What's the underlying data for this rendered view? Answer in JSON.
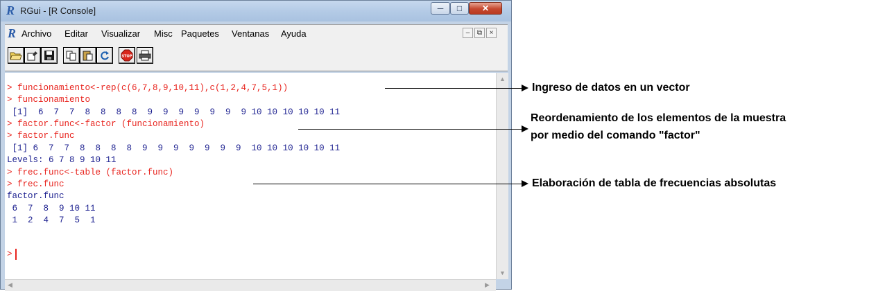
{
  "window": {
    "title": "RGui - [R Console]",
    "logo": "R",
    "caption_buttons": [
      "minimize-icon",
      "maximize-icon",
      "close-icon"
    ]
  },
  "menubar": {
    "logo": "R",
    "items": [
      "Archivo",
      "Editar",
      "Visualizar",
      "Misc",
      "Paquetes",
      "Ventanas",
      "Ayuda"
    ]
  },
  "toolbar": {
    "buttons": [
      "open-script-icon",
      "load-workspace-icon",
      "save-icon",
      "copy-icon",
      "paste-icon",
      "refresh-icon",
      "stop-icon",
      "print-icon"
    ],
    "stop_label": "STOP"
  },
  "console": {
    "lines": [
      {
        "type": "cmd",
        "text": "> funcionamiento<-rep(c(6,7,8,9,10,11),c(1,2,4,7,5,1))"
      },
      {
        "type": "cmd",
        "text": "> funcionamiento"
      },
      {
        "type": "out",
        "text": " [1]  6  7  7  8  8  8  8  9  9  9  9  9  9  9 10 10 10 10 10 11"
      },
      {
        "type": "cmd",
        "text": "> factor.func<-factor (funcionamiento)"
      },
      {
        "type": "cmd",
        "text": "> factor.func"
      },
      {
        "type": "out",
        "text": " [1] 6  7  7  8  8  8  8  9  9  9  9  9  9  9  10 10 10 10 10 11"
      },
      {
        "type": "out",
        "text": "Levels: 6 7 8 9 10 11"
      },
      {
        "type": "cmd",
        "text": "> frec.func<-table (factor.func)"
      },
      {
        "type": "cmd",
        "text": "> frec.func"
      },
      {
        "type": "out",
        "text": "factor.func"
      },
      {
        "type": "out",
        "text": " 6  7  8  9 10 11"
      },
      {
        "type": "out",
        "text": " 1  2  4  7  5  1"
      },
      {
        "type": "cmd",
        "text": "> "
      }
    ]
  },
  "annotations": [
    {
      "text": "Ingreso de datos en un vector"
    },
    {
      "text": "Reordenamiento de los elementos de la muestra"
    },
    {
      "text": "por medio del comando \"factor\""
    },
    {
      "text": "Elaboración de tabla de frecuencias absolutas"
    }
  ],
  "colors": {
    "command": "#e8231d",
    "output": "#1b1f8f",
    "titlebar": "#b4cbe6",
    "close_button": "#c5482f"
  }
}
